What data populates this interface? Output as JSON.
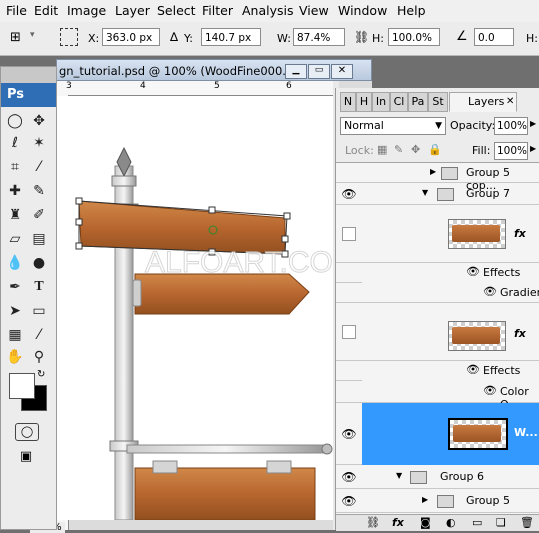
{
  "menu": [
    "File",
    "Edit",
    "Image",
    "Layer",
    "Select",
    "Filter",
    "Analysis",
    "View",
    "Window",
    "Help"
  ],
  "options": {
    "x_label": "X:",
    "x_value": "363.0 px",
    "y_label": "Y:",
    "y_value": "140.7 px",
    "w_label": "W:",
    "w_value": "87.4%",
    "h_label": "H:",
    "h_value": "100.0%",
    "angle_value": "0.0",
    "extra_label": "H:"
  },
  "document": {
    "title": "gn_tutorial.psd @ 100% (WoodFine000...",
    "ruler_ticks": [
      "3",
      "4",
      "5",
      "6"
    ],
    "zoom": "100%",
    "watermark": "ALFOART.COM"
  },
  "tools": {
    "badge": "Ps"
  },
  "layers_panel": {
    "tabs": [
      "N",
      "H",
      "In",
      "Cl",
      "Pa",
      "St"
    ],
    "active_tab": "Layers",
    "blend_mode": "Normal",
    "opacity_label": "Opacity:",
    "opacity_value": "100%",
    "lock_label": "Lock:",
    "fill_label": "Fill:",
    "fill_value": "100%",
    "rows": {
      "group5copy": "Group 5 cop...",
      "group7": "Group 7",
      "effects1": "Effects",
      "gradient": "Gradien...",
      "effects2": "Effects",
      "color_overlay": "Color O...",
      "selected_layer": "W...",
      "group6": "Group 6",
      "group5": "Group 5"
    },
    "fx": "fx"
  },
  "colors": {
    "selection": "#3399ff",
    "ps_blue": "#2f6db5",
    "wood": "#b8662f"
  }
}
